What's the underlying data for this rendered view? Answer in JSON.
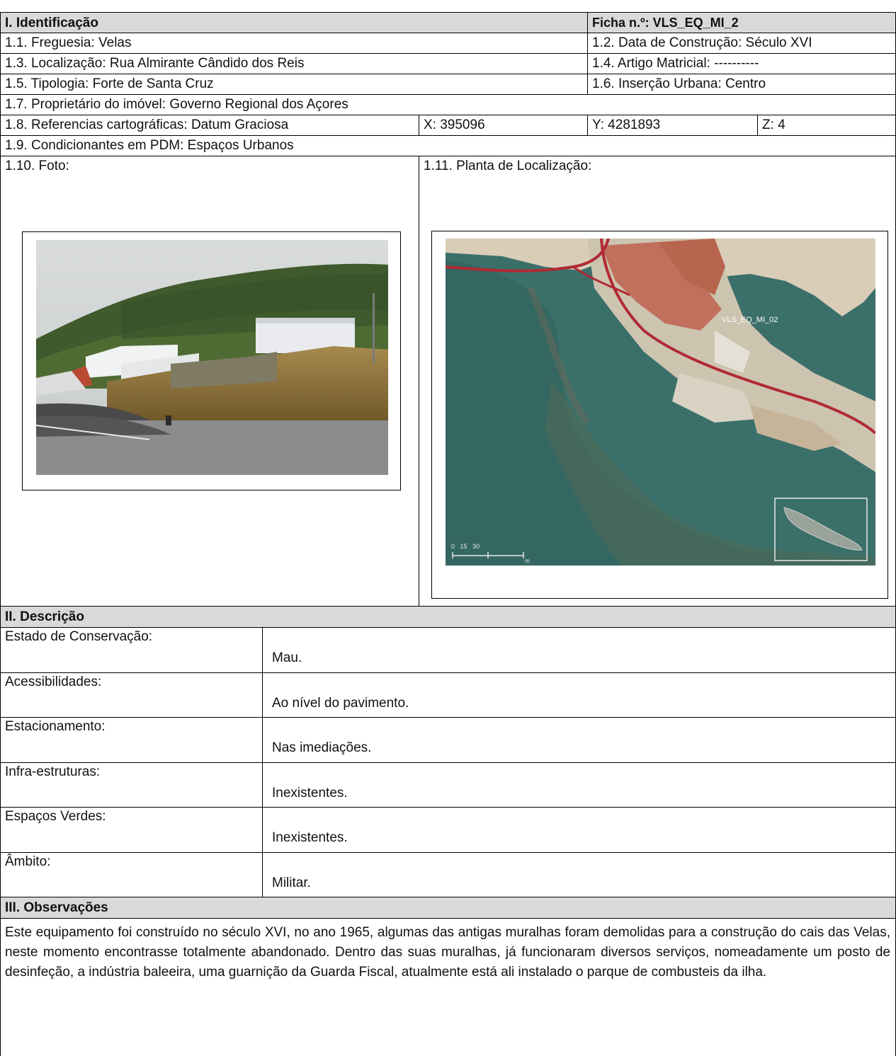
{
  "identificacao": {
    "title": "I. Identificação",
    "ficha": "Ficha n.º: VLS_EQ_MI_2",
    "freguesia": "1.1. Freguesia: Velas",
    "data_construcao": "1.2. Data de Construção: Século XVI",
    "localizacao": "1.3. Localização: Rua Almirante Cândido dos Reis",
    "artigo": "1.4. Artigo Matricial: ----------",
    "tipologia": "1.5. Tipologia: Forte de Santa Cruz",
    "insercao": "1.6. Inserção Urbana: Centro",
    "proprietario": "1.7. Proprietário do imóvel: Governo Regional dos Açores",
    "referencias": "1.8. Referencias cartográficas: Datum Graciosa",
    "x": "X: 395096",
    "y": "Y: 4281893",
    "z": "Z: 4",
    "condicionantes": "1.9. Condicionantes em PDM: Espaços Urbanos",
    "foto_label": "1.10. Foto:",
    "planta_label": "1.11. Planta de Localização:",
    "map_scale": "0   15   30",
    "map_scale_unit": "m",
    "map_code": "VLS_EQ_MI_02"
  },
  "descricao": {
    "title": "II. Descrição",
    "rows": [
      {
        "label": "Estado de Conservação:",
        "value": "Mau."
      },
      {
        "label": "Acessibilidades:",
        "value": "Ao nível do pavimento."
      },
      {
        "label": "Estacionamento:",
        "value": "Nas imediações."
      },
      {
        "label": "Infra-estruturas:",
        "value": "Inexistentes."
      },
      {
        "label": "Espaços Verdes:",
        "value": "Inexistentes."
      },
      {
        "label": "Âmbito:",
        "value": "Militar."
      }
    ]
  },
  "observacoes": {
    "title": "III. Observações",
    "text": "Este equipamento foi construído no século XVI, no ano 1965, algumas das antigas muralhas foram demolidas para a construção do cais das Velas, neste momento encontrasse totalmente abandonado. Dentro das suas muralhas, já funcionaram diversos serviços, nomeadamente um posto de desinfeção, a indústria baleeira, uma guarnição da Guarda Fiscal, atualmente está ali instalado o parque de combusteis da ilha."
  }
}
